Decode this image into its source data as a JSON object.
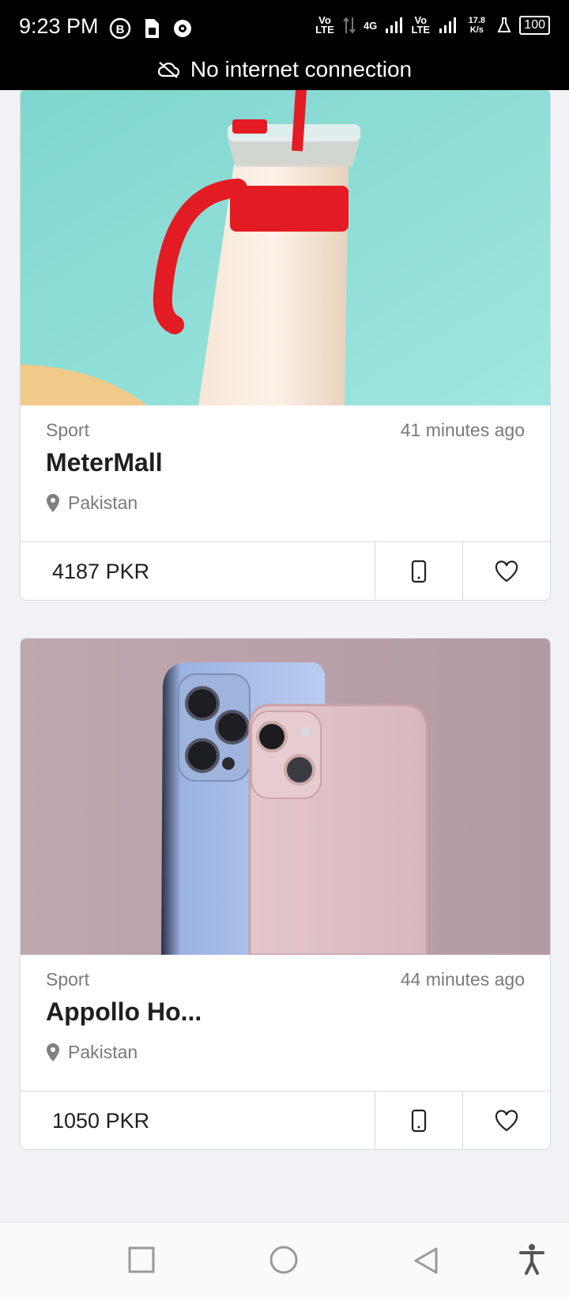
{
  "status_bar": {
    "time": "9:23 PM",
    "speed": "17.8 K/s",
    "battery": "100",
    "network_labels": [
      "Vo LTE",
      "4G",
      "Vo LTE"
    ]
  },
  "banner": {
    "text": "No internet connection"
  },
  "listings": [
    {
      "category": "Sport",
      "time_ago": "41 minutes ago",
      "title": "MeterMall",
      "location": "Pakistan",
      "price": "4187 PKR",
      "image_desc": "tumbler"
    },
    {
      "category": "Sport",
      "time_ago": "44 minutes ago",
      "title": "Appollo Ho...",
      "location": "Pakistan",
      "price": "1050 PKR",
      "image_desc": "phones"
    }
  ],
  "colors": {
    "status_bg": "#000000",
    "page_bg": "#f1f2f5",
    "card_bg": "#ffffff",
    "muted_text": "#7a7a7a",
    "title_text": "#1f1f1f"
  },
  "icons": {
    "offline": "cloud-off-icon",
    "phone": "smartphone-icon",
    "favorite": "heart-icon",
    "location": "location-pin-icon",
    "nav_recent": "square-icon",
    "nav_home": "circle-icon",
    "nav_back": "triangle-back-icon",
    "accessibility": "accessibility-icon"
  }
}
